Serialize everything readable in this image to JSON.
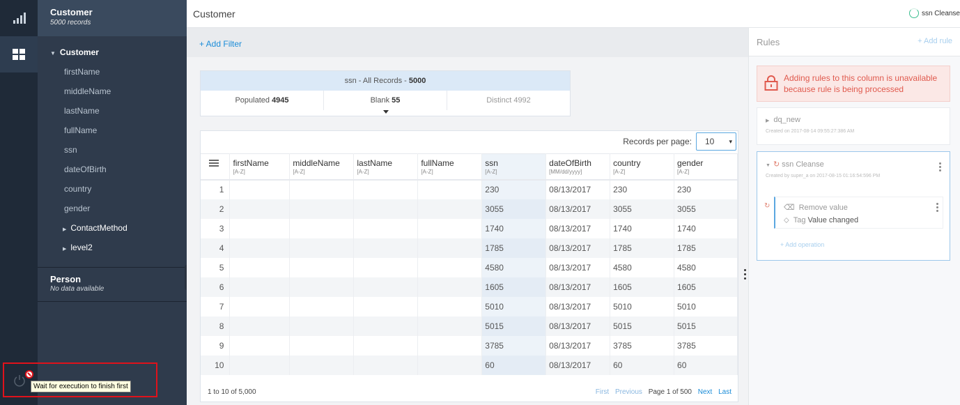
{
  "dataset": {
    "title": "Customer",
    "records": "5000 records"
  },
  "tree": {
    "root": "Customer",
    "fields": [
      "firstName",
      "middleName",
      "lastName",
      "fullName",
      "ssn",
      "dateOfBirth",
      "country",
      "gender"
    ],
    "groups": [
      "ContactMethod",
      "level2"
    ]
  },
  "person": {
    "title": "Person",
    "subtitle": "No data available"
  },
  "tooltip": "Wait for execution to finish first",
  "header": {
    "title": "Customer",
    "status": "ssn Cleanse"
  },
  "filter": {
    "add_label": "+ Add Filter"
  },
  "stats": {
    "heading_prefix": "ssn - All Records - ",
    "heading_total": "5000",
    "populated_label": "Populated ",
    "populated_value": "4945",
    "blank_label": "Blank ",
    "blank_value": "55",
    "distinct": "Distinct 4992"
  },
  "grid": {
    "records_per_page_label": "Records per page:",
    "records_per_page_value": "10",
    "columns": [
      {
        "name": "firstName",
        "sort": "[A-Z]"
      },
      {
        "name": "middleName",
        "sort": "[A-Z]"
      },
      {
        "name": "lastName",
        "sort": "[A-Z]"
      },
      {
        "name": "fullName",
        "sort": "[A-Z]"
      },
      {
        "name": "ssn",
        "sort": "[A-Z]"
      },
      {
        "name": "dateOfBirth",
        "sort": "[MM/dd/yyyy]"
      },
      {
        "name": "country",
        "sort": "[A-Z]"
      },
      {
        "name": "gender",
        "sort": "[A-Z]"
      }
    ],
    "rows": [
      {
        "n": "1",
        "ssn": "230",
        "dob": "08/13/2017",
        "country": "230",
        "gender": "230"
      },
      {
        "n": "2",
        "ssn": "3055",
        "dob": "08/13/2017",
        "country": "3055",
        "gender": "3055"
      },
      {
        "n": "3",
        "ssn": "1740",
        "dob": "08/13/2017",
        "country": "1740",
        "gender": "1740"
      },
      {
        "n": "4",
        "ssn": "1785",
        "dob": "08/13/2017",
        "country": "1785",
        "gender": "1785"
      },
      {
        "n": "5",
        "ssn": "4580",
        "dob": "08/13/2017",
        "country": "4580",
        "gender": "4580"
      },
      {
        "n": "6",
        "ssn": "1605",
        "dob": "08/13/2017",
        "country": "1605",
        "gender": "1605"
      },
      {
        "n": "7",
        "ssn": "5010",
        "dob": "08/13/2017",
        "country": "5010",
        "gender": "5010"
      },
      {
        "n": "8",
        "ssn": "5015",
        "dob": "08/13/2017",
        "country": "5015",
        "gender": "5015"
      },
      {
        "n": "9",
        "ssn": "3785",
        "dob": "08/13/2017",
        "country": "3785",
        "gender": "3785"
      },
      {
        "n": "10",
        "ssn": "60",
        "dob": "08/13/2017",
        "country": "60",
        "gender": "60"
      }
    ],
    "summary": "1 to 10 of 5,000",
    "pager": {
      "first": "First",
      "previous": "Previous",
      "page": "Page 1 of 500",
      "next": "Next",
      "last": "Last"
    }
  },
  "rules": {
    "title": "Rules",
    "add_rule": "+ Add rule",
    "warning": "Adding rules to this column is unavailable because rule is being processed",
    "items": [
      {
        "name": "dq_new",
        "meta": "Created on 2017-08-14 09:55:27:386 AM"
      },
      {
        "name": "ssn Cleanse",
        "meta": "Created by super_a on 2017-08-15 01:16:54:596 PM"
      }
    ],
    "operation": {
      "action": "Remove value",
      "tag_prefix": "Tag ",
      "tag_value": "Value changed"
    },
    "add_operation": "+ Add operation"
  },
  "colors": {
    "accent": "#1a8cd8",
    "sidebar": "#2f3b4c",
    "rail": "#1f2a38",
    "warning": "#e05a4e",
    "highlight": "#e0121b"
  }
}
